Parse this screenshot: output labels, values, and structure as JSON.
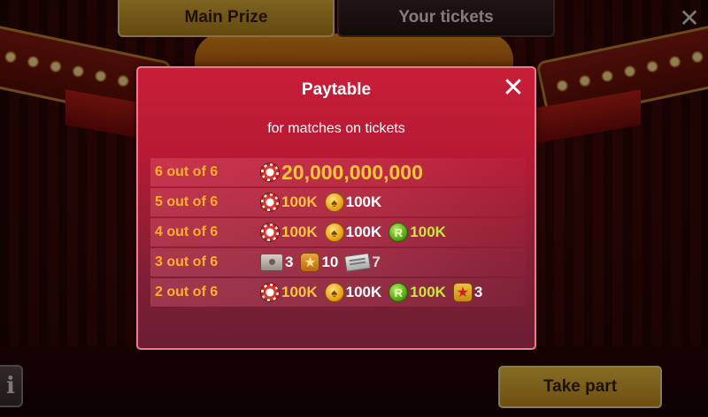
{
  "tabs": {
    "main_prize": "Main Prize",
    "your_tickets": "Your tickets"
  },
  "top_close": "✕",
  "info_label": "i",
  "take_part_label": "Take part",
  "dialog": {
    "title": "Paytable",
    "close": "✕",
    "subtitle": "for matches on tickets",
    "rows": [
      {
        "label": "6 out of 6",
        "prizes": [
          {
            "icon": "chip-icon",
            "value": "20,000,000,000",
            "style": "big"
          }
        ]
      },
      {
        "label": "5 out of 6",
        "prizes": [
          {
            "icon": "chip-icon",
            "value": "100K",
            "style": "gold"
          },
          {
            "icon": "coin-icon",
            "value": "100K",
            "style": "white"
          }
        ]
      },
      {
        "label": "4 out of 6",
        "prizes": [
          {
            "icon": "chip-icon",
            "value": "100K",
            "style": "gold"
          },
          {
            "icon": "coin-icon",
            "value": "100K",
            "style": "white"
          },
          {
            "icon": "rcoin-icon",
            "value": "100K",
            "style": "green"
          }
        ]
      },
      {
        "label": "3 out of 6",
        "prizes": [
          {
            "icon": "case-icon",
            "value": "3",
            "style": "white"
          },
          {
            "icon": "star-icon",
            "value": "10",
            "style": "white"
          },
          {
            "icon": "ticket-icon",
            "value": "7",
            "style": "grey"
          }
        ]
      },
      {
        "label": "2 out of 6",
        "prizes": [
          {
            "icon": "chip-icon",
            "value": "100K",
            "style": "gold"
          },
          {
            "icon": "coin-icon",
            "value": "100K",
            "style": "white"
          },
          {
            "icon": "rcoin-icon",
            "value": "100K",
            "style": "green"
          },
          {
            "icon": "star-red-icon",
            "value": "3",
            "style": "white"
          }
        ]
      }
    ]
  },
  "colors": {
    "dialog_bg": "#c81e38",
    "dialog_border": "#f07a8a",
    "row_label": "#ffb12a",
    "gold_text": "#ffc63a",
    "green_text": "#c8e83a",
    "tab_active": "#e5b63c",
    "take_part": "#f2c543"
  }
}
